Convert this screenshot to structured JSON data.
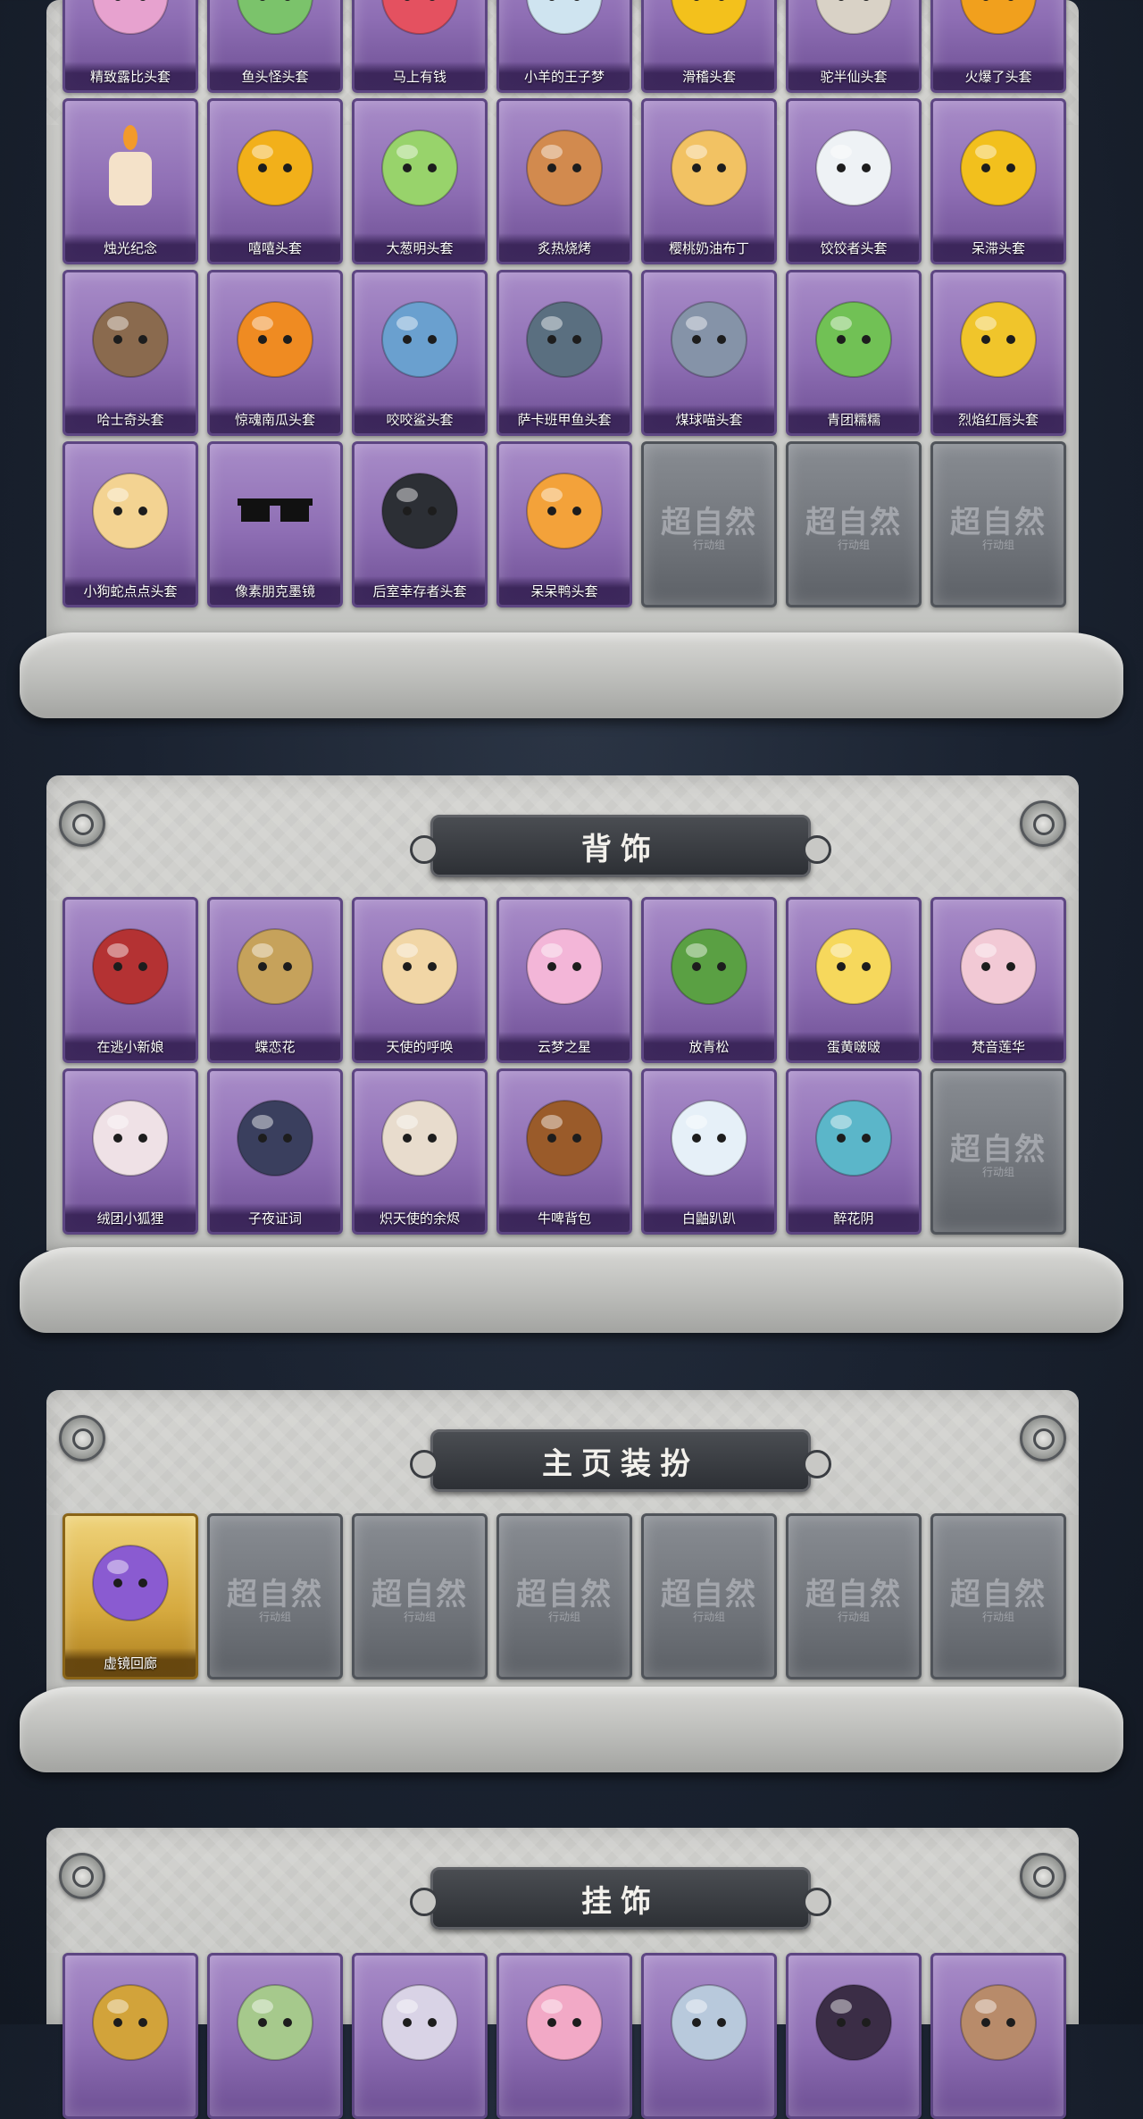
{
  "watermark": {
    "main": "超自然",
    "sub": "行动组"
  },
  "sections": {
    "headwear": {
      "items": [
        {
          "name": "精致露比头套",
          "shape": "round",
          "color": "#e7a2cf"
        },
        {
          "name": "鱼头怪头套",
          "shape": "round",
          "color": "#7bc36b"
        },
        {
          "name": "马上有钱",
          "shape": "round",
          "color": "#e45160"
        },
        {
          "name": "小羊的王子梦",
          "shape": "round",
          "color": "#cfe4f0"
        },
        {
          "name": "滑稽头套",
          "shape": "round",
          "color": "#f3c11c"
        },
        {
          "name": "驼半仙头套",
          "shape": "round",
          "color": "#d9d2c6"
        },
        {
          "name": "火爆了头套",
          "shape": "round",
          "color": "#f1a01d"
        },
        {
          "name": "烛光纪念",
          "shape": "candle",
          "color": "#f4e2c9"
        },
        {
          "name": "嘻嘻头套",
          "shape": "round",
          "color": "#f2b01a"
        },
        {
          "name": "大葱明头套",
          "shape": "round",
          "color": "#98d36b"
        },
        {
          "name": "炙热烧烤",
          "shape": "round",
          "color": "#d28a4e"
        },
        {
          "name": "樱桃奶油布丁",
          "shape": "round",
          "color": "#f2c263"
        },
        {
          "name": "饺饺者头套",
          "shape": "round",
          "color": "#eef2f5"
        },
        {
          "name": "呆滞头套",
          "shape": "round",
          "color": "#f2c01d"
        },
        {
          "name": "哈士奇头套",
          "shape": "round",
          "color": "#8a6a4e"
        },
        {
          "name": "惊魂南瓜头套",
          "shape": "round",
          "color": "#ef8b22"
        },
        {
          "name": "咬咬鲨头套",
          "shape": "round",
          "color": "#6aa0cf"
        },
        {
          "name": "萨卡班甲鱼头套",
          "shape": "round",
          "color": "#5a6f80"
        },
        {
          "name": "煤球喵头套",
          "shape": "round",
          "color": "#8593a8"
        },
        {
          "name": "青团糯糯",
          "shape": "round",
          "color": "#71c155"
        },
        {
          "name": "烈焰红唇头套",
          "shape": "round",
          "color": "#f0c52b"
        },
        {
          "name": "小狗蛇点点头套",
          "shape": "round",
          "color": "#f3d392"
        },
        {
          "name": "像素朋克墨镜",
          "shape": "glasses",
          "color": "#111111"
        },
        {
          "name": "后室幸存者头套",
          "shape": "round",
          "color": "#2c2f35"
        },
        {
          "name": "呆呆鸭头套",
          "shape": "round",
          "color": "#f3a23a"
        }
      ],
      "empty_count": 3
    },
    "back": {
      "title": "背饰",
      "items": [
        {
          "name": "在逃小新娘",
          "shape": "round",
          "color": "#b43233"
        },
        {
          "name": "蝶恋花",
          "shape": "round",
          "color": "#c6a25b"
        },
        {
          "name": "天使的呼唤",
          "shape": "round",
          "color": "#f1d6a6"
        },
        {
          "name": "云梦之星",
          "shape": "round",
          "color": "#f3b6d8"
        },
        {
          "name": "放青松",
          "shape": "round",
          "color": "#5aa043"
        },
        {
          "name": "蛋黄啵啵",
          "shape": "round",
          "color": "#f6d85c"
        },
        {
          "name": "梵音莲华",
          "shape": "round",
          "color": "#f2c9d5"
        },
        {
          "name": "绒团小狐狸",
          "shape": "round",
          "color": "#efe1e6"
        },
        {
          "name": "子夜证词",
          "shape": "round",
          "color": "#3a3f5e"
        },
        {
          "name": "炽天使的余烬",
          "shape": "round",
          "color": "#e8dccd"
        },
        {
          "name": "牛啤背包",
          "shape": "round",
          "color": "#9a5b2a"
        },
        {
          "name": "白鼬趴趴",
          "shape": "round",
          "color": "#e6f0f8"
        },
        {
          "name": "醉花阴",
          "shape": "round",
          "color": "#5bb6c9"
        }
      ],
      "empty_count": 1
    },
    "homepage": {
      "title": "主页装扮",
      "items": [
        {
          "name": "虚镜回廊",
          "shape": "round",
          "color": "#8a5bd1"
        }
      ],
      "empty_count": 6
    },
    "hanging": {
      "title": "挂饰",
      "items": [
        {
          "name": "",
          "shape": "round",
          "color": "#d2a33a"
        },
        {
          "name": "",
          "shape": "round",
          "color": "#a6c98c"
        },
        {
          "name": "",
          "shape": "round",
          "color": "#d9d3e6"
        },
        {
          "name": "",
          "shape": "round",
          "color": "#f2a9c6"
        },
        {
          "name": "",
          "shape": "round",
          "color": "#b8c9dc"
        },
        {
          "name": "",
          "shape": "round",
          "color": "#3b2d46"
        },
        {
          "name": "",
          "shape": "round",
          "color": "#b88b6a"
        }
      ],
      "empty_count": 0
    }
  }
}
